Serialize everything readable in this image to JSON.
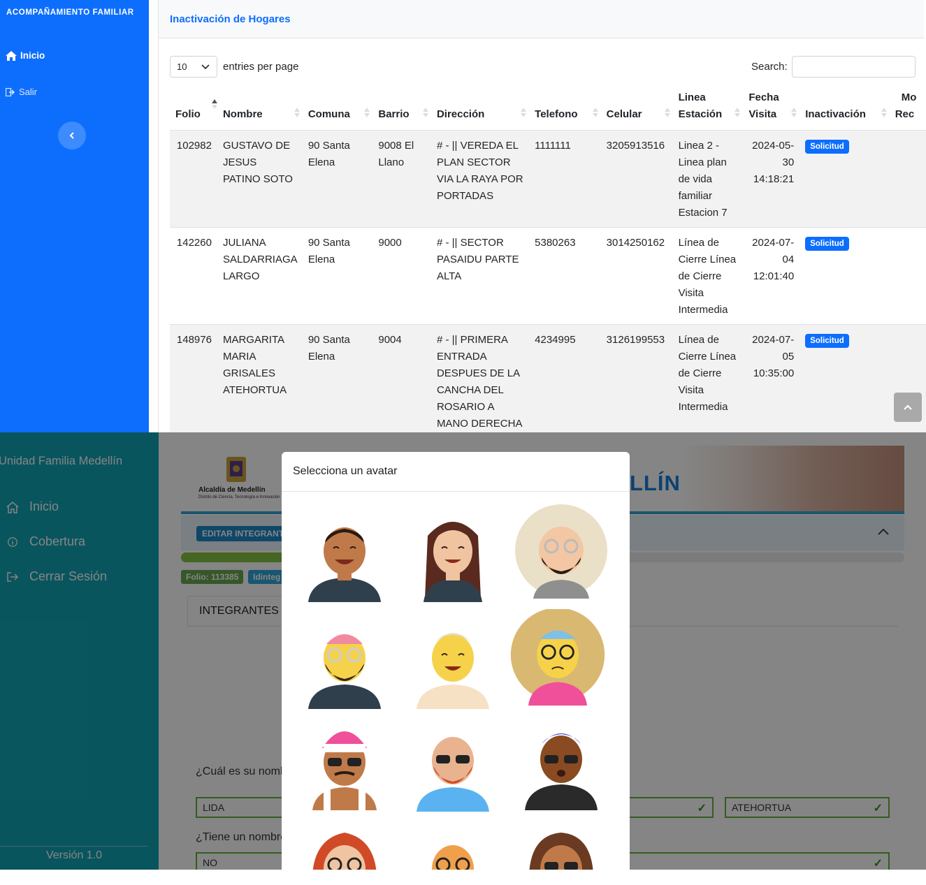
{
  "top_app": {
    "brand": "ACOMPAÑAMIENTO FAMILIAR",
    "nav": {
      "inicio": "Inicio",
      "salir": "Salir"
    },
    "page_title": "Inactivación de Hogares",
    "entries": {
      "value": "10",
      "label": "entries per page"
    },
    "search": {
      "label": "Search:",
      "value": ""
    },
    "columns": {
      "folio": "Folio",
      "nombre": "Nombre",
      "comuna": "Comuna",
      "barrio": "Barrio",
      "direccion": "Dirección",
      "telefono": "Telefono",
      "celular": "Celular",
      "linea_l1": "Linea",
      "linea_l2": "Estación",
      "fecha_l1": "Fecha",
      "fecha_l2": "Visita",
      "inactivacion": "Inactivación",
      "motivo_l1": "Mo",
      "motivo_l2": "Rec"
    },
    "rows": [
      {
        "folio": "102982",
        "nombre": "GUSTAVO DE JESUS PATINO SOTO",
        "comuna": "90 Santa Elena",
        "barrio": "9008 El Llano",
        "direccion": "# - || VEREDA EL PLAN SECTOR VIA LA RAYA POR PORTADAS",
        "telefono": "1111111",
        "celular": "3205913516",
        "linea": "Linea 2 - Linea plan de vida familiar Estacion 7",
        "fecha": "2024-05-30 14:18:21",
        "inactivacion": "Solicitud"
      },
      {
        "folio": "142260",
        "nombre": "JULIANA SALDARRIAGA LARGO",
        "comuna": "90 Santa Elena",
        "barrio": "9000",
        "direccion": "# - || SECTOR PASAIDU PARTE ALTA",
        "telefono": "5380263",
        "celular": "3014250162",
        "linea": "Línea de Cierre Línea de Cierre Visita Intermedia",
        "fecha": "2024-07-04 12:01:40",
        "inactivacion": "Solicitud"
      },
      {
        "folio": "148976",
        "nombre": "MARGARITA MARIA GRISALES ATEHORTUA",
        "comuna": "90 Santa Elena",
        "barrio": "9004",
        "direccion": "# - || PRIMERA ENTRADA DESPUES DE LA CANCHA DEL ROSARIO A MANO DERECHA",
        "telefono": "4234995",
        "celular": "3126199553",
        "linea": "Línea de Cierre Línea de Cierre Visita Intermedia",
        "fecha": "2024-07-05 10:35:00",
        "inactivacion": "Solicitud"
      }
    ]
  },
  "bottom_app": {
    "app_title": "Unidad Familia Medellín",
    "nav": {
      "inicio": "Inicio",
      "cobertura": "Cobertura",
      "cerrar": "Cerrar Sesión"
    },
    "version": "Versión 1.0",
    "logo": {
      "name": "Alcaldía de Medellín",
      "sub1": "Distrito de",
      "sub2": "Ciencia, Tecnología e Innovación"
    },
    "banner_title": "LLÍN",
    "edit_button": "EDITAR INTEGRANT",
    "progress": 0.24,
    "folio_tag": "Folio: 113385",
    "id_tag": "Idinteg",
    "tab": "INTEGRANTES",
    "q_nombre": "¿Cuál es su nomb",
    "field_nombre": "LIDA",
    "field_apellido": "ATEHORTUA",
    "q_otro_nombre": "¿Tiene un nombre",
    "field_otro": "NO",
    "modal_title": "Selecciona un avatar",
    "colors": {
      "top_sidebar": "#0d6efd",
      "bottom_sidebar": "#12a4b5",
      "badge": "#0d6efd",
      "valid": "#62b23a"
    }
  }
}
